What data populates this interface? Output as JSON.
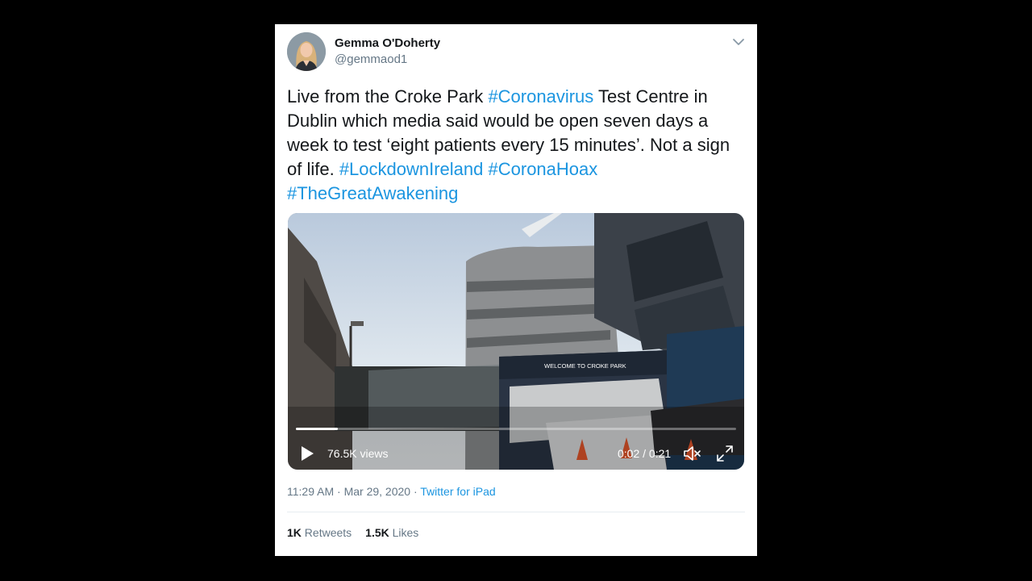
{
  "author": {
    "name": "Gemma O'Doherty",
    "handle": "@gemmaod1"
  },
  "tweet": {
    "segments": [
      {
        "text": "Live from the Croke Park ",
        "type": "text"
      },
      {
        "text": "#Coronavirus",
        "type": "hashtag"
      },
      {
        "text": " Test Centre in Dublin which media said would be open seven days a week to test ‘eight patients every 15 minutes’. Not a sign of life. ",
        "type": "text"
      },
      {
        "text": "#LockdownIreland",
        "type": "hashtag"
      },
      {
        "text": " ",
        "type": "text"
      },
      {
        "text": "#CoronaHoax",
        "type": "hashtag"
      },
      {
        "text": " ",
        "type": "text"
      },
      {
        "text": "#TheGreatAwakening",
        "type": "hashtag"
      }
    ]
  },
  "video": {
    "views": "76.5K views",
    "time": "0:02 / 0:21",
    "progress": 0.095,
    "sign_title": "WELCOME TO CROKE PARK"
  },
  "meta": {
    "time": "11:29 AM",
    "date": "Mar 29, 2020",
    "source": "Twitter for iPad"
  },
  "stats": {
    "retweets_count": "1K",
    "retweets_label": "Retweets",
    "likes_count": "1.5K",
    "likes_label": "Likes"
  },
  "colors": {
    "link": "#1b95e0",
    "text": "#14171a",
    "secondary": "#657786"
  }
}
